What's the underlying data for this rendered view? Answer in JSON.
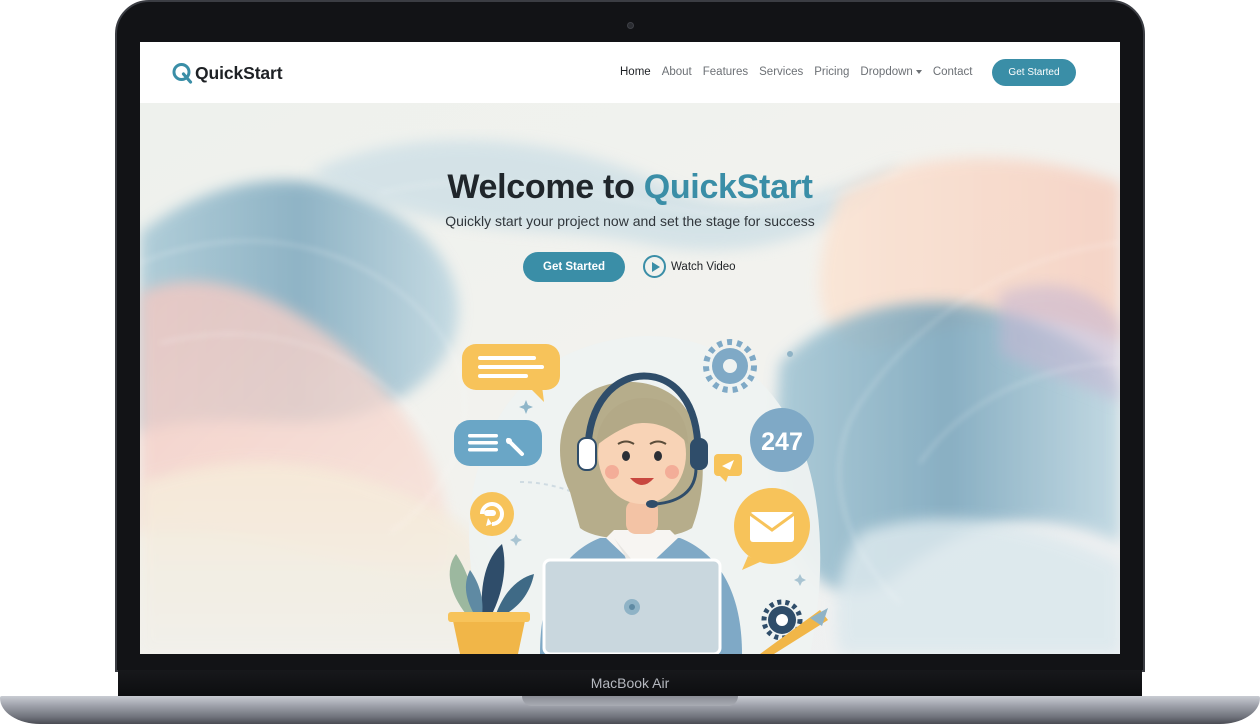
{
  "device": {
    "label": "MacBook Air"
  },
  "header": {
    "logo_text": "QuickStart",
    "nav": [
      {
        "label": "Home",
        "active": true
      },
      {
        "label": "About",
        "active": false
      },
      {
        "label": "Features",
        "active": false
      },
      {
        "label": "Services",
        "active": false
      },
      {
        "label": "Pricing",
        "active": false
      },
      {
        "label": "Dropdown",
        "active": false,
        "has_dropdown": true
      },
      {
        "label": "Contact",
        "active": false
      }
    ],
    "cta_label": "Get Started"
  },
  "hero": {
    "title_prefix": "Welcome to ",
    "title_accent": "QuickStart",
    "subtitle": "Quickly start your project now and set the stage for success",
    "primary_label": "Get Started",
    "secondary_label": "Watch Video",
    "badge_text": "247"
  },
  "colors": {
    "accent": "#3a8ea7",
    "text_dark": "#20262b",
    "nav_text": "#6c7075",
    "bubble_yellow": "#f7c35a",
    "bubble_blue": "#6aa6c6"
  },
  "icons": {
    "logo": "q-logo-icon",
    "play": "play-circle-icon",
    "dropdown": "caret-down-icon"
  }
}
